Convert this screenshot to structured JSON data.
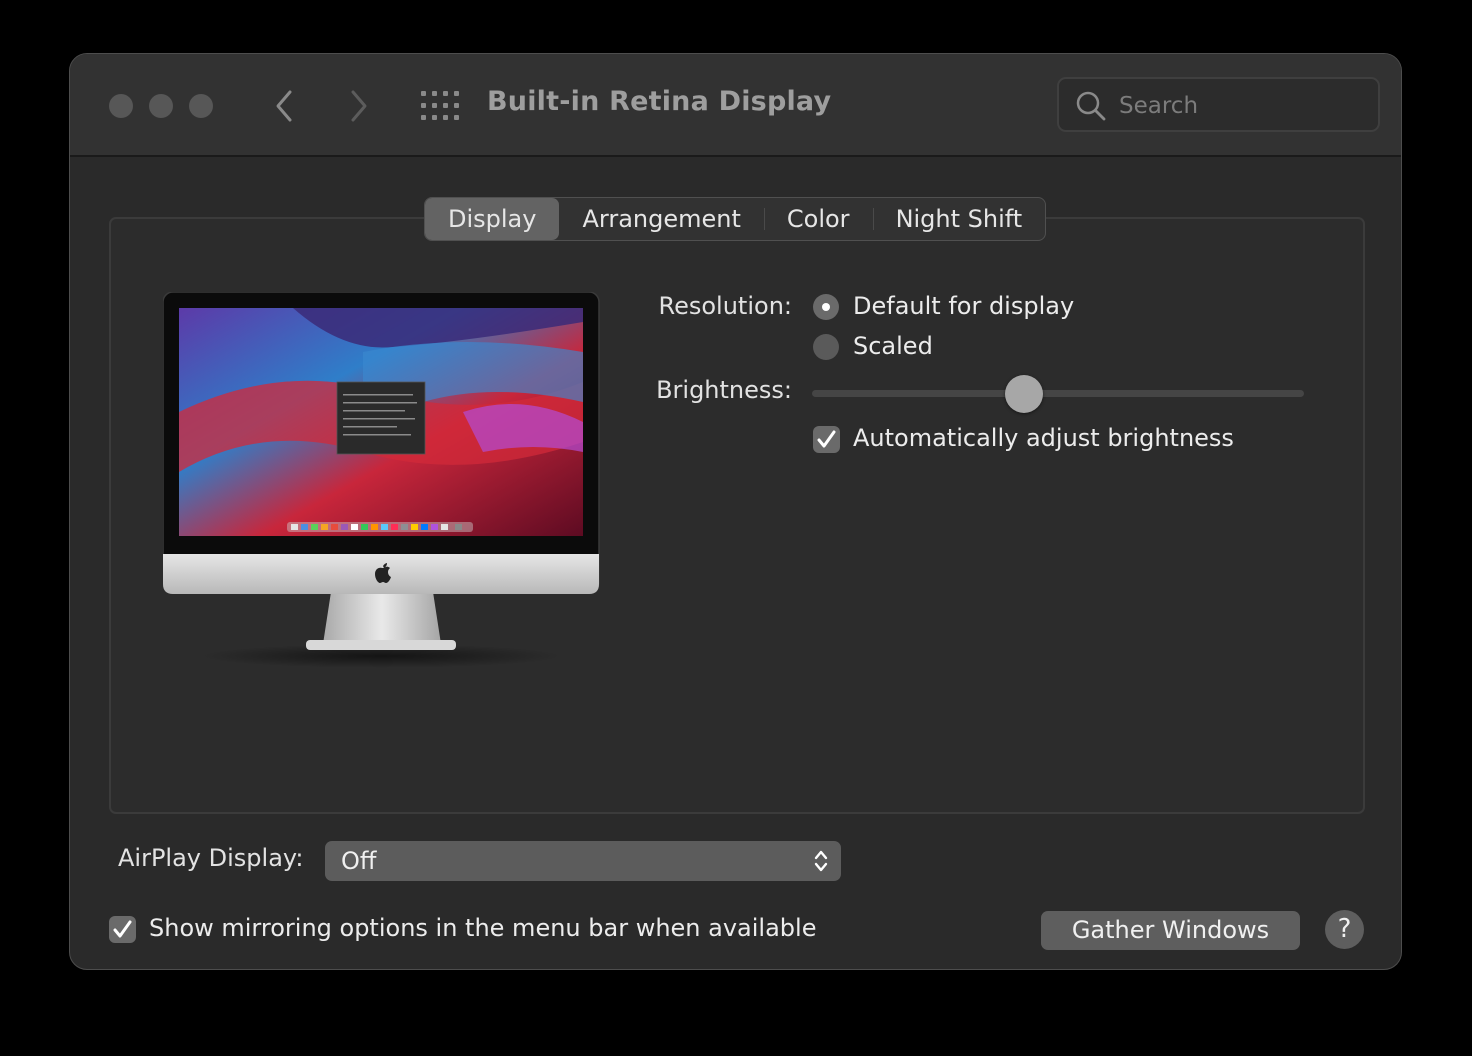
{
  "window": {
    "title": "Built-in Retina Display",
    "traffic_lights": [
      "close",
      "minimize",
      "zoom"
    ],
    "back_icon": "chevron-left-icon",
    "forward_icon": "chevron-right-icon",
    "grid_icon": "show-all-grid-icon"
  },
  "search": {
    "placeholder": "Search",
    "value": "",
    "icon": "search-icon"
  },
  "tabs": [
    {
      "label": "Display",
      "active": true
    },
    {
      "label": "Arrangement",
      "active": false
    },
    {
      "label": "Color",
      "active": false
    },
    {
      "label": "Night Shift",
      "active": false
    }
  ],
  "settings": {
    "resolution_label": "Resolution:",
    "resolution_options": [
      {
        "label": "Default for display",
        "selected": true
      },
      {
        "label": "Scaled",
        "selected": false
      }
    ],
    "brightness_label": "Brightness:",
    "brightness_level": 0.43,
    "auto_brightness_label": "Automatically adjust brightness",
    "auto_brightness_checked": true
  },
  "airplay": {
    "label": "AirPlay Display:",
    "selected": "Off"
  },
  "mirroring": {
    "label": "Show mirroring options in the menu bar when available",
    "checked": true
  },
  "buttons": {
    "gather_windows": "Gather Windows",
    "help": "?"
  },
  "colors": {
    "window_bg": "#2a2a2a",
    "titlebar_bg": "#323232",
    "active_tab": "#636363",
    "control_gray": "#5e5e5e"
  }
}
